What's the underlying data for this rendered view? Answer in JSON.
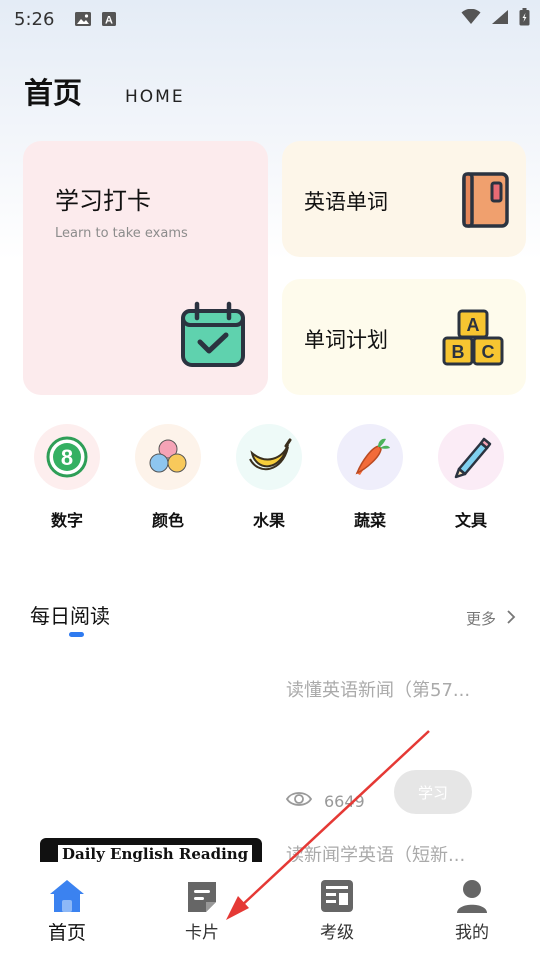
{
  "status_bar": {
    "time": "5:26",
    "icons": [
      "image-icon",
      "font-a-icon",
      "wifi-icon",
      "signal-icon",
      "battery-icon"
    ]
  },
  "header": {
    "title": "首页",
    "subtitle": "HOME"
  },
  "cards": {
    "checkin": {
      "title": "学习打卡",
      "subtitle": "Learn to take exams",
      "icon": "calendar-check-icon"
    },
    "words": {
      "title": "英语单词",
      "icon": "book-icon"
    },
    "plan": {
      "title": "单词计划",
      "icon": "abc-blocks-icon"
    }
  },
  "categories": [
    {
      "label": "数字",
      "icon": "number-eight-icon",
      "bg": "#fdeeee"
    },
    {
      "label": "颜色",
      "icon": "color-balls-icon",
      "bg": "#fdf3ea"
    },
    {
      "label": "水果",
      "icon": "banana-icon",
      "bg": "#eefaf8"
    },
    {
      "label": "蔬菜",
      "icon": "carrot-icon",
      "bg": "#efeefb"
    },
    {
      "label": "文具",
      "icon": "pencil-icon",
      "bg": "#fbecf6"
    }
  ],
  "daily_reading": {
    "title": "每日阅读",
    "more": "更多",
    "articles": [
      {
        "title": "读懂英语新闻（第57...",
        "views": "6649",
        "button": "学习"
      },
      {
        "title": "读新闻学英语（短新...",
        "thumb_text": "Daily English Reading"
      }
    ]
  },
  "tabbar": {
    "tabs": [
      {
        "label": "首页",
        "icon": "home-icon",
        "active": true
      },
      {
        "label": "卡片",
        "icon": "card-icon",
        "active": false
      },
      {
        "label": "考级",
        "icon": "exam-icon",
        "active": false
      },
      {
        "label": "我的",
        "icon": "profile-icon",
        "active": false
      }
    ]
  },
  "colors": {
    "accent": "#2f7bf0",
    "annotation_arrow": "#e53935"
  }
}
